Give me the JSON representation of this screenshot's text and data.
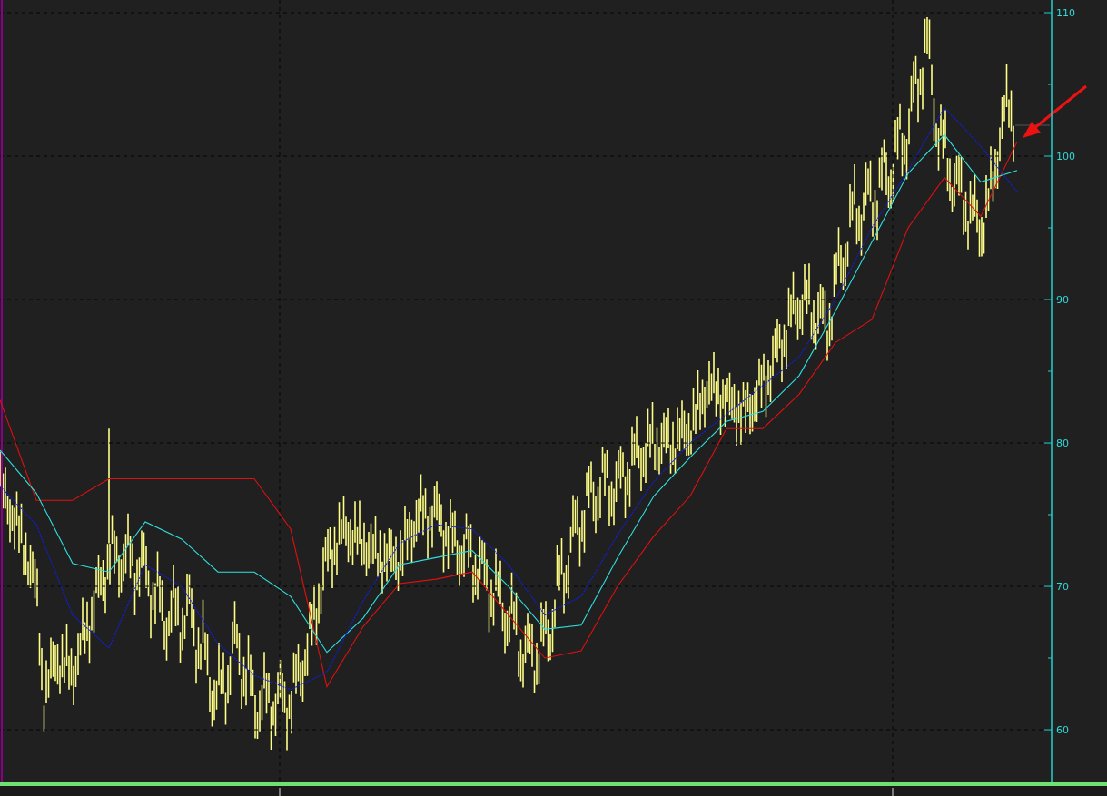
{
  "chart": {
    "chart_data": {
      "type": "line",
      "categories": [
        null,
        null,
        null,
        null,
        null,
        null,
        null,
        null,
        null,
        null,
        null,
        null,
        null,
        null,
        null,
        null,
        null,
        null,
        null,
        null,
        null,
        null,
        null,
        null,
        null,
        null,
        null,
        null,
        null
      ],
      "ylim": [
        56.3,
        110.9
      ],
      "grid": true,
      "yticks": [
        {
          "value": 110,
          "label": "110"
        },
        {
          "value": 100,
          "label": "100"
        },
        {
          "value": 90,
          "label": "90"
        },
        {
          "value": 80,
          "label": "80"
        },
        {
          "value": 70,
          "label": "70"
        },
        {
          "value": 60,
          "label": "60"
        }
      ],
      "series": [
        {
          "color": "#e01010",
          "values": [
            83,
            76,
            76,
            77.5,
            77.5,
            77.5,
            77.5,
            77.5,
            74,
            63,
            67.2,
            70.2,
            70.5,
            71,
            68,
            65,
            65.5,
            70,
            73.5,
            76.3,
            81,
            81,
            83.4,
            87,
            88.6,
            95,
            98.5,
            95.8,
            101
          ]
        },
        {
          "color": "#30e0e0",
          "values": [
            79.5,
            76.5,
            71.6,
            71,
            74.5,
            73.3,
            71,
            71,
            69.3,
            65.4,
            67.8,
            71.5,
            72,
            72.5,
            70,
            67,
            67.3,
            72,
            76.3,
            79,
            81.5,
            82.2,
            84.7,
            89.2,
            94,
            98.8,
            101.5,
            98.2,
            99
          ]
        },
        {
          "color": "#1020e0",
          "line_style": "dashed",
          "values": [
            77,
            74.3,
            68,
            65.7,
            71.5,
            70,
            66,
            63.8,
            62.8,
            64,
            69,
            73,
            74.3,
            74,
            71.5,
            68,
            69.3,
            73.6,
            77.3,
            80,
            82,
            84,
            86,
            90,
            95,
            99,
            103.4,
            100.7,
            97.5
          ]
        }
      ]
    }
  }
}
